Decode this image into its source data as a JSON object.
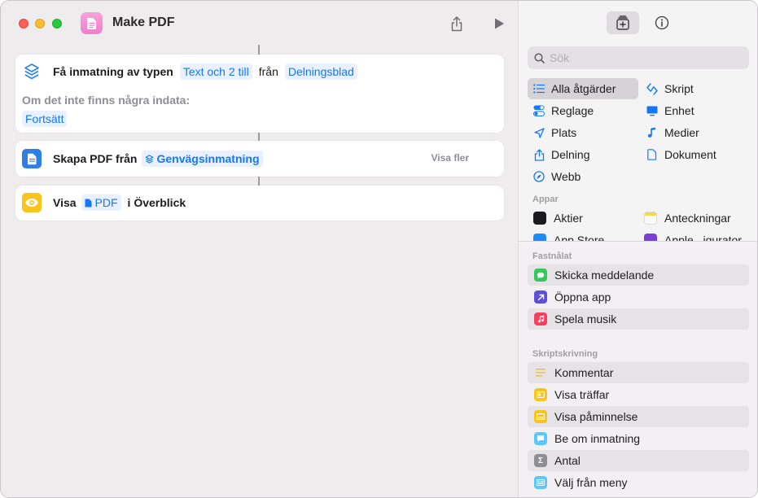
{
  "window": {
    "title": "Make PDF"
  },
  "editor": {
    "action1": {
      "label": "Få inmatning av typen",
      "type_token": "Text och 2 till",
      "from_label": "från",
      "source_token": "Delningsblad",
      "fallback_label": "Om det inte finns några indata:",
      "fallback_token": "Fortsätt"
    },
    "action2": {
      "label": "Skapa PDF från",
      "input_token": "Genvägsinmatning",
      "show_more": "Visa fler"
    },
    "action3": {
      "label": "Visa",
      "pdf_token": "PDF",
      "suffix": "i Överblick"
    }
  },
  "sidebar": {
    "search_placeholder": "Sök",
    "categories": {
      "all": "Alla åtgärder",
      "scripting": "Skript",
      "controls": "Reglage",
      "device": "Enhet",
      "location": "Plats",
      "media": "Medier",
      "sharing": "Delning",
      "documents": "Dokument",
      "web": "Webb"
    },
    "apps_label": "Appar",
    "apps": {
      "stocks": "Aktier",
      "notes": "Anteckningar",
      "appstore": "App Store",
      "configurator": "Apple...igurator"
    },
    "pinned_label": "Fastnålat",
    "pinned": {
      "p1": "Skicka meddelande",
      "p2": "Öppna app",
      "p3": "Spela musik"
    },
    "scripting_label": "Skriptskrivning",
    "scripting_items": {
      "s1": "Kommentar",
      "s2": "Visa träffar",
      "s3": "Visa påminnelse",
      "s4": "Be om inmatning",
      "s5": "Antal",
      "s6": "Välj från meny"
    }
  },
  "colors": {
    "accent": "#1478f6",
    "token_bg": "#e8f1fd",
    "app_icon": "#ee7fcc"
  }
}
